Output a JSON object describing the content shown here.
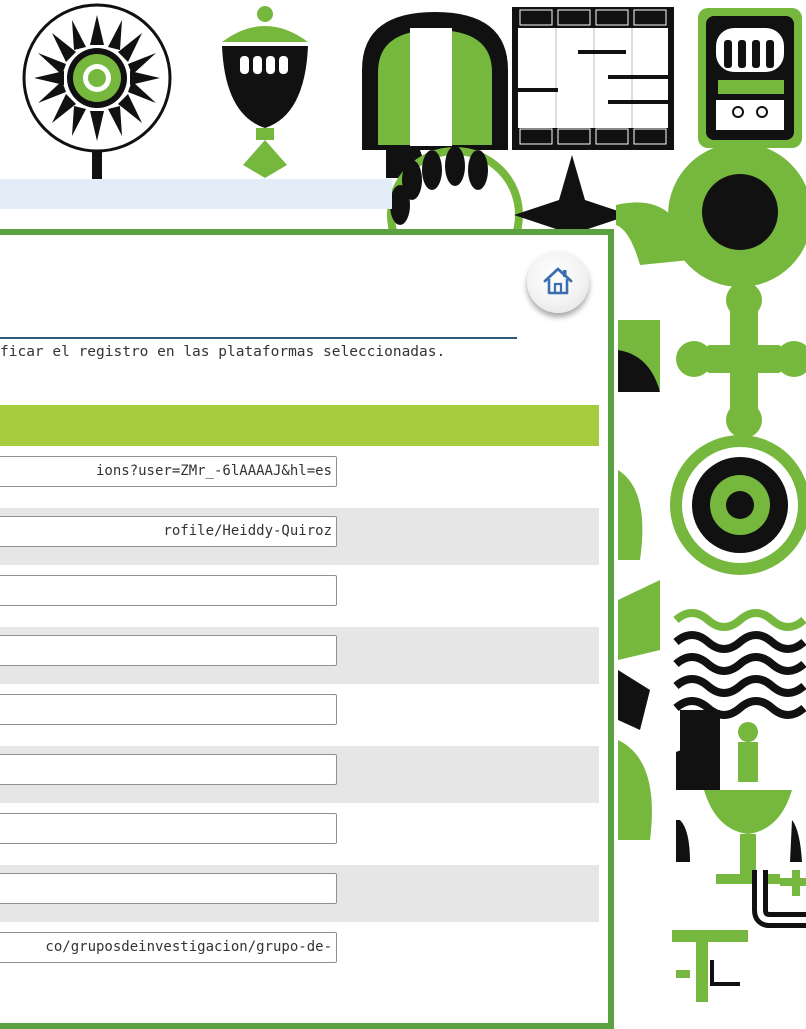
{
  "instruction_text": "ficar el registro en las plataformas seleccionadas.",
  "home_button": {
    "icon": "home-icon"
  },
  "section_header": "",
  "platform_urls": [
    "ions?user=ZMr_-6lAAAAJ&hl=es",
    "rofile/Heiddy-Quiroz",
    "",
    "",
    "",
    "",
    "",
    "",
    "co/gruposdeinvestigacion/grupo-de-"
  ],
  "colors": {
    "frame_green": "#5ba043",
    "section_bar": "#a6cb3c",
    "pattern_green": "#76b83d",
    "pattern_black": "#111111",
    "divider": "#2d5a78"
  }
}
